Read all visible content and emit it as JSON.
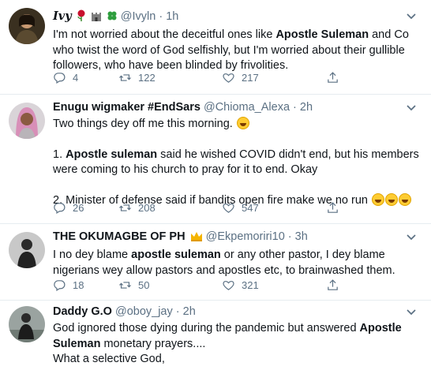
{
  "tweets": [
    {
      "name": "Ivy",
      "handle": "@Ivyln",
      "time": "1h",
      "paragraphs": [
        [
          {
            "t": "I'm not worried about the deceitful ones like "
          },
          {
            "t": "Apostle Suleman",
            "b": true
          },
          {
            "t": " and Co who twist the word of God selfishly, but I'm worried about their gullible followers, who have been blinded by frivolities."
          }
        ]
      ],
      "replies": "4",
      "retweets": "122",
      "likes": "217"
    },
    {
      "name": "Enugu wigmaker #EndSars",
      "handle": "@Chioma_Alexa",
      "time": "2h",
      "paragraphs": [
        [
          {
            "t": "Two things dey off me this morning. "
          },
          {
            "emoji": "laughing"
          }
        ],
        [
          {
            "t": "1. "
          },
          {
            "t": "Apostle suleman",
            "b": true
          },
          {
            "t": " said he wished COVID didn't end, but his members were coming to his church to pray for it  to end. Okay"
          }
        ],
        [
          {
            "t": "2. Minister of defense said if bandits open fire make we no run "
          },
          {
            "emoji": "laughing"
          },
          {
            "emoji": "laughing"
          },
          {
            "emoji": "laughing"
          }
        ]
      ],
      "replies": "26",
      "retweets": "208",
      "likes": "547"
    },
    {
      "name": "THE OKUMAGBE OF PH",
      "handle": "@Ekpemoriri10",
      "time": "3h",
      "paragraphs": [
        [
          {
            "t": "I no dey  blame "
          },
          {
            "t": "apostle suleman",
            "b": true
          },
          {
            "t": " or any other pastor, I dey blame nigerians wey allow pastors and apostles etc, to brainwashed them."
          }
        ]
      ],
      "replies": "18",
      "retweets": "50",
      "likes": "321"
    },
    {
      "name": "Daddy G.O",
      "handle": "@oboy_jay",
      "time": "2h",
      "paragraphs": [
        [
          {
            "t": "God ignored those dying during the pandemic but answered "
          },
          {
            "t": "Apostle Suleman",
            "b": true
          },
          {
            "t": " monetary prayers....\nWhat a selective God,"
          }
        ]
      ]
    }
  ],
  "colors": {
    "text": "#0f1419",
    "secondary": "#5b7083",
    "border": "#e6ecf0",
    "crown": "#f4b400"
  },
  "icons": [
    "reply-icon",
    "retweet-icon",
    "like-icon",
    "share-icon",
    "more-icon",
    "rose-emoji",
    "castle-emoji",
    "clover-emoji",
    "crown-emoji",
    "laughing-emoji"
  ]
}
